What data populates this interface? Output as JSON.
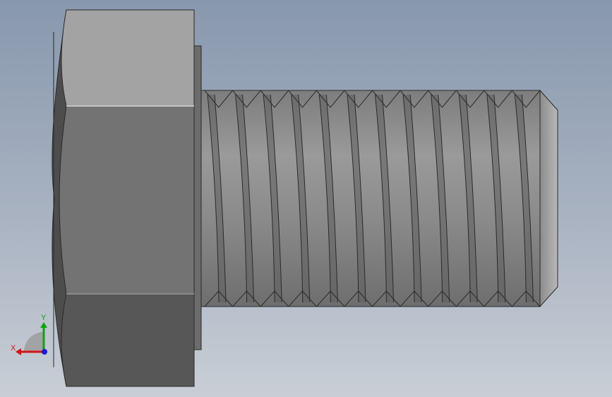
{
  "viewport": {
    "background_top": "#8898ad",
    "background_bottom": "#c9ced6"
  },
  "model": {
    "type": "hex-bolt",
    "thread_turns": 12
  },
  "triad": {
    "x_label": "X",
    "y_label": "Y",
    "x_color": "#d21414",
    "y_color": "#12a012",
    "z_color": "#1a1ad0"
  }
}
